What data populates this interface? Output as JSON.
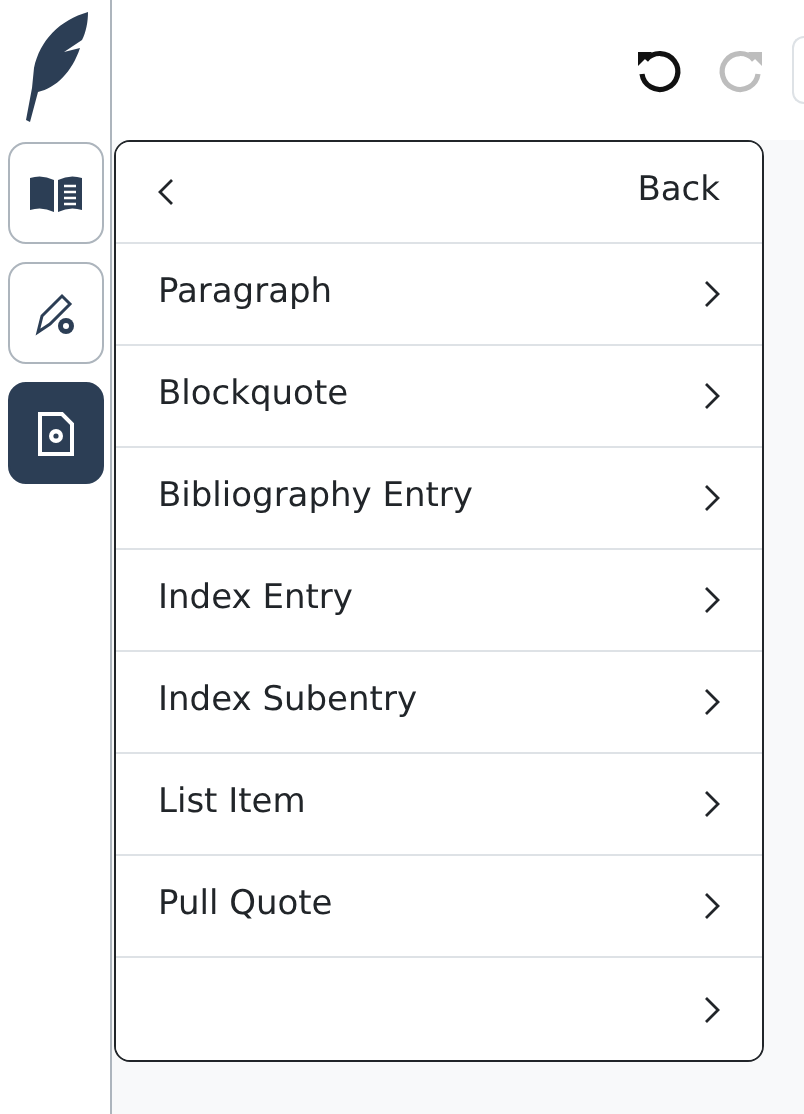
{
  "sidebar": {
    "items": [
      {
        "selected": false
      },
      {
        "selected": false
      },
      {
        "selected": true
      }
    ]
  },
  "toolbar": {
    "undo": {
      "disabled": false
    },
    "redo": {
      "disabled": true
    }
  },
  "menu": {
    "back": {
      "label": "Back"
    },
    "items": [
      {
        "kind": "labeled",
        "label": "Paragraph"
      },
      {
        "kind": "labeled",
        "label": "Blockquote"
      },
      {
        "kind": "labeled",
        "label": "Bibliography Entry"
      },
      {
        "kind": "labeled",
        "label": "Index Entry"
      },
      {
        "kind": "labeled",
        "label": "Index Subentry"
      },
      {
        "kind": "labeled",
        "label": "List Item"
      },
      {
        "kind": "labeled",
        "label": "Pull Quote"
      },
      {
        "kind": "blank"
      }
    ]
  }
}
